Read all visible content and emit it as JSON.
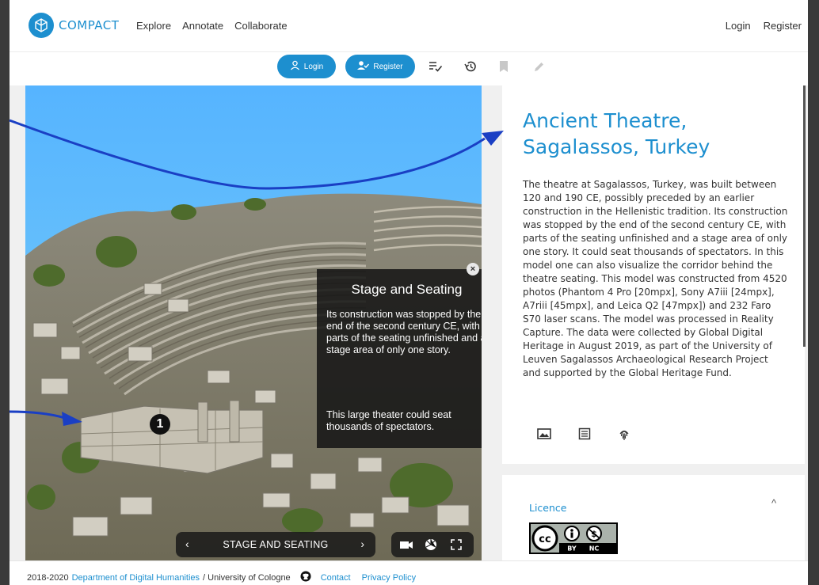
{
  "header": {
    "logo_text": "COMPACT",
    "nav": [
      "Explore",
      "Annotate",
      "Collaborate"
    ],
    "login": "Login",
    "register": "Register"
  },
  "toolbar": {
    "login_label": "Login",
    "register_label": "Register"
  },
  "viewer": {
    "overlay_title": "Stage and Seating",
    "overlay_text_1": "Its construction was stopped by the end of the second century CE, with parts of the seating unfinished and a stage area of only one story.",
    "overlay_text_2": "This large theater could seat thousands of spectators.",
    "marker_number": "1",
    "nav_label": "STAGE AND SEATING",
    "prev_symbol": "‹",
    "next_symbol": "›",
    "close_symbol": "×"
  },
  "info": {
    "title": "Ancient Theatre, Sagalassos, Turkey",
    "description": "The theatre at Sagalassos, Turkey, was built between 120 and 190 CE, possibly preceded by an earlier construction in the Hellenistic tradition. Its construction was stopped by the end of the second century CE, with parts of the seating unfinished and a stage area of only one story. It could seat thousands of spectators. In this model one can also visualize the corridor behind the theatre seating. This model was constructed from 4520 photos (Phantom 4 Pro [20mpx], Sony A7iii [24mpx], A7riii [45mpx], and Leica Q2 [47mpx]) and 232 Faro S70 laser scans. The model was processed in Reality Capture. The data were collected by Global Digital Heritage in August 2019, as part of the University of Leuven Sagalassos Archaeological Research Project and supported by the Global Heritage Fund."
  },
  "licence": {
    "label": "Licence",
    "badge_parts": [
      "BY",
      "NC"
    ],
    "chevron": "^"
  },
  "footer": {
    "years": "2018-2020",
    "dept_link": "Department of Digital Humanities",
    "university": "/ University of Cologne",
    "contact": "Contact",
    "privacy": "Privacy Policy"
  },
  "colors": {
    "accent": "#1d8fcf",
    "frame": "#3a3a3a",
    "arrow": "#1a3fc4"
  },
  "icons": [
    "logo-cube-icon",
    "user-icon",
    "user-check-icon",
    "list-check-icon",
    "history-icon",
    "bookmark-icon",
    "pencil-icon",
    "image-icon",
    "list-icon",
    "fingerprint-icon",
    "camera-icon",
    "aperture-icon",
    "fullscreen-icon",
    "github-icon",
    "creative-commons-icon"
  ]
}
